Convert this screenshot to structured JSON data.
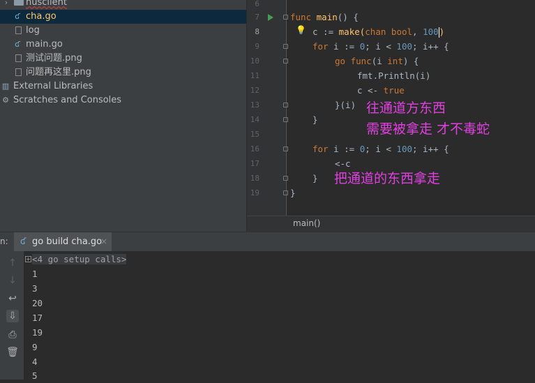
{
  "project_tree": {
    "items": [
      {
        "label": "nusclient",
        "icon": "folder-icon"
      },
      {
        "label": "cha.go",
        "icon": "go-file-icon",
        "selected": true
      },
      {
        "label": "log",
        "icon": "file-icon"
      },
      {
        "label": "main.go",
        "icon": "go-file-icon"
      },
      {
        "label": "测试问题.png",
        "icon": "image-file-icon"
      },
      {
        "label": "问题再这里.png",
        "icon": "image-file-icon"
      },
      {
        "label": "External Libraries",
        "icon": "library-icon"
      },
      {
        "label": "Scratches and Consoles",
        "icon": "scratches-icon"
      }
    ]
  },
  "editor": {
    "line_numbers": [
      "6",
      "7",
      "8",
      "9",
      "10",
      "11",
      "12",
      "13",
      "14",
      "15",
      "16",
      "17",
      "18",
      "19"
    ],
    "current_line": "8",
    "code": {
      "l7": {
        "kw": "func",
        "name": "main",
        "rest": "() {"
      },
      "l8": {
        "pre": "c := ",
        "make": "make",
        "paren": "(",
        "chan": "chan",
        "bool": "bool",
        "sep": ", ",
        "num": "100",
        "close": ")"
      },
      "l9": {
        "kw": "for",
        "a": " i := ",
        "n0": "0",
        "b": "; i < ",
        "n100": "100",
        "c": "; i++ {"
      },
      "l10": {
        "kw": "go",
        "kwfunc": "func",
        "a": "(i ",
        "int": "int",
        "b": ") {"
      },
      "l11": {
        "text": "fmt.Println(i)"
      },
      "l12": {
        "a": "c <- ",
        "kw": "true"
      },
      "l13": {
        "text": "}(i)"
      },
      "l14": {
        "text": "}"
      },
      "l16": {
        "kw": "for",
        "a": " i := ",
        "n0": "0",
        "b": "; i < ",
        "n100": "100",
        "c": "; i++ {"
      },
      "l17": {
        "text": "<-c"
      },
      "l18": {
        "text": "}"
      },
      "l19": {
        "text": "}"
      }
    },
    "annotations": {
      "note1": "往通道方东西",
      "note2": "需要被拿走 才不毒蛇",
      "note3": "把通道的东西拿走"
    },
    "breadcrumb": "main()"
  },
  "run_panel": {
    "prefix": "n:",
    "tab_label": "go build cha.go",
    "tab_close": "×",
    "setup_calls": "<4 go setup calls>",
    "output": [
      "1",
      "3",
      "20",
      "17",
      "19",
      "9",
      "4",
      "5"
    ]
  },
  "colors": {
    "keyword": "#cc7832",
    "function": "#ffc66d",
    "number": "#6897bb",
    "annotation": "#e040e0",
    "selection": "#0d293e"
  }
}
